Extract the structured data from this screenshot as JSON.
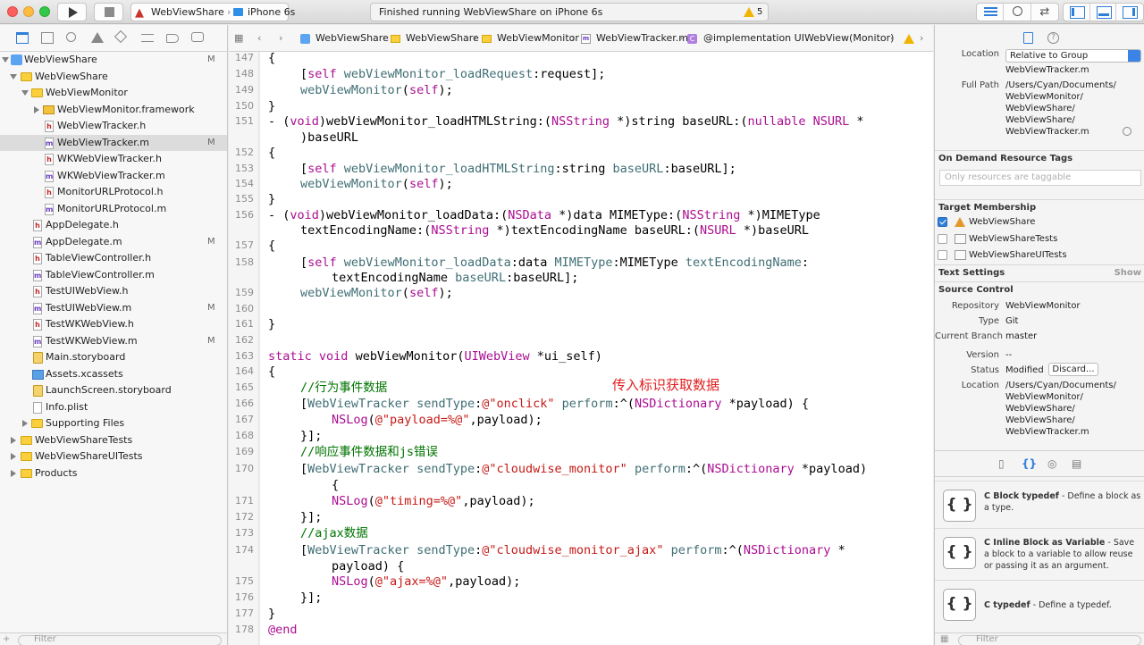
{
  "toolbar": {
    "scheme_name": "WebViewShare",
    "device_name": "iPhone 6s",
    "status_text": "Finished running WebViewShare on iPhone 6s",
    "warning_count": "5"
  },
  "navigator": {
    "filter_placeholder": "Filter",
    "items": [
      {
        "label": "WebViewShare",
        "scm": "M"
      },
      {
        "label": "WebViewShare",
        "scm": ""
      },
      {
        "label": "WebViewMonitor",
        "scm": ""
      },
      {
        "label": "WebViewMonitor.framework",
        "scm": ""
      },
      {
        "label": "WebViewTracker.h",
        "scm": ""
      },
      {
        "label": "WebViewTracker.m",
        "scm": "M"
      },
      {
        "label": "WKWebViewTracker.h",
        "scm": ""
      },
      {
        "label": "WKWebViewTracker.m",
        "scm": ""
      },
      {
        "label": "MonitorURLProtocol.h",
        "scm": ""
      },
      {
        "label": "MonitorURLProtocol.m",
        "scm": ""
      },
      {
        "label": "AppDelegate.h",
        "scm": ""
      },
      {
        "label": "AppDelegate.m",
        "scm": "M"
      },
      {
        "label": "TableViewController.h",
        "scm": ""
      },
      {
        "label": "TableViewController.m",
        "scm": ""
      },
      {
        "label": "TestUIWebView.h",
        "scm": ""
      },
      {
        "label": "TestUIWebView.m",
        "scm": "M"
      },
      {
        "label": "TestWKWebView.h",
        "scm": ""
      },
      {
        "label": "TestWKWebView.m",
        "scm": "M"
      },
      {
        "label": "Main.storyboard",
        "scm": ""
      },
      {
        "label": "Assets.xcassets",
        "scm": ""
      },
      {
        "label": "LaunchScreen.storyboard",
        "scm": ""
      },
      {
        "label": "Info.plist",
        "scm": ""
      },
      {
        "label": "Supporting Files",
        "scm": ""
      },
      {
        "label": "WebViewShareTests",
        "scm": ""
      },
      {
        "label": "WebViewShareUITests",
        "scm": ""
      },
      {
        "label": "Products",
        "scm": ""
      }
    ]
  },
  "jumpbar": [
    "WebViewShare",
    "WebViewShare",
    "WebViewMonitor",
    "WebViewTracker.m",
    "@implementation UIWebView(Monitor)"
  ],
  "editor": {
    "line_numbers": [
      "147",
      "148",
      "149",
      "150",
      "151",
      "152",
      "153",
      "154",
      "155",
      "156",
      "157",
      "158",
      "159",
      "160",
      "161",
      "162",
      "163",
      "164",
      "165",
      "166",
      "167",
      "168",
      "169",
      "170",
      "171",
      "172",
      "173",
      "174",
      "175",
      "176",
      "177",
      "178"
    ],
    "annotation": "传入标识获取数据",
    "code": {
      "l147": "{",
      "l148_self": "self",
      "l148_method": "webViewMonitor_loadRequest",
      "l148_rest": ":request];",
      "l149_fn": "webViewMonitor",
      "l149_self": "self",
      "l150": "}",
      "l151_a": "- (",
      "l151_void": "void",
      "l151_b": ")webViewMonitor_loadHTMLString:(",
      "l151_cls": "NSString",
      "l151_c": " *)string baseURL:(",
      "l151_nullable": "nullable",
      "l151_cls2": "NSURL",
      "l151_d": " *",
      "l151_cont": ")baseURL",
      "l152": "{",
      "l153_self": "self",
      "l153_method": "webViewMonitor_loadHTMLString",
      "l153_a": ":string ",
      "l153_arg": "baseURL",
      "l153_b": ":baseURL];",
      "l154_fn": "webViewMonitor",
      "l154_self": "self",
      "l155": "}",
      "l156_a": "- (",
      "l156_void": "void",
      "l156_b": ")webViewMonitor_loadData:(",
      "l156_cls": "NSData",
      "l156_c": " *)data MIMEType:(",
      "l156_cls2": "NSString",
      "l156_d": " *)MIMEType",
      "l156_cont_a": "textEncodingName:(",
      "l156_cont_cls": "NSString",
      "l156_cont_b": " *)textEncodingName baseURL:(",
      "l156_cont_cls2": "NSURL",
      "l156_cont_c": " *)baseURL",
      "l157": "{",
      "l158_self": "self",
      "l158_method": "webViewMonitor_loadData",
      "l158_a": ":data ",
      "l158_arg1": "MIMEType",
      "l158_b": ":MIMEType ",
      "l158_arg2": "textEncodingName",
      "l158_c": ":",
      "l158_cont_a": "textEncodingName ",
      "l158_cont_arg": "baseURL",
      "l158_cont_b": ":baseURL];",
      "l159_fn": "webViewMonitor",
      "l159_self": "self",
      "l161": "}",
      "l163_static": "static",
      "l163_void": "void",
      "l163_a": " webViewMonitor(",
      "l163_cls": "UIWebView",
      "l163_b": " *ui_self)",
      "l164": "{",
      "l165": "//行为事件数据",
      "l166_cls": "WebViewTracker",
      "l166_sel1": "sendType",
      "l166_str": "@\"onclick\"",
      "l166_sel2": "perform",
      "l166_a": ":^(",
      "l166_cls2": "NSDictionary",
      "l166_b": " *payload) {",
      "l167_fn": "NSLog",
      "l167_str": "@\"payload=%@\"",
      "l167_rest": ",payload);",
      "l168": "}];",
      "l169": "//响应事件数据和js错误",
      "l170_cls": "WebViewTracker",
      "l170_sel1": "sendType",
      "l170_str": "@\"cloudwise_monitor\"",
      "l170_sel2": "perform",
      "l170_a": ":^(",
      "l170_cls2": "NSDictionary",
      "l170_b": " *payload)",
      "l170_cont": "{",
      "l171_fn": "NSLog",
      "l171_str": "@\"timing=%@\"",
      "l171_rest": ",payload);",
      "l172": "}];",
      "l173": "//ajax数据",
      "l174_cls": "WebViewTracker",
      "l174_sel1": "sendType",
      "l174_str": "@\"cloudwise_monitor_ajax\"",
      "l174_sel2": "perform",
      "l174_a": ":^(",
      "l174_cls2": "NSDictionary",
      "l174_b": " *",
      "l174_cont": "payload) {",
      "l175_fn": "NSLog",
      "l175_str": "@\"ajax=%@\"",
      "l175_rest": ",payload);",
      "l176": "}];",
      "l177": "}",
      "l178": "@end"
    }
  },
  "inspector": {
    "location_key": "Location",
    "location_value": "Relative to Group",
    "file_name": "WebViewTracker.m",
    "fullpath_key": "Full Path",
    "fullpath_lines": [
      "/Users/Cyan/Documents/",
      "WebViewMonitor/",
      "WebViewShare/",
      "WebViewShare/",
      "WebViewTracker.m"
    ],
    "on_demand_header": "On Demand Resource Tags",
    "tags_placeholder": "Only resources are taggable",
    "target_header": "Target Membership",
    "targets": [
      "WebViewShare",
      "WebViewShareTests",
      "WebViewShareUITests"
    ],
    "text_settings_header": "Text Settings",
    "text_settings_show": "Show",
    "source_control_header": "Source Control",
    "repository_key": "Repository",
    "repository_value": "WebViewMonitor",
    "type_key": "Type",
    "type_value": "Git",
    "branch_key": "Current Branch",
    "branch_value": "master",
    "version_key": "Version",
    "version_value": "--",
    "status_key": "Status",
    "status_value": "Modified",
    "discard_label": "Discard...",
    "sc_location_key": "Location",
    "sc_location_lines": [
      "/Users/Cyan/Documents/",
      "WebViewMonitor/",
      "WebViewShare/",
      "WebViewShare/",
      "WebViewTracker.m"
    ],
    "library": [
      {
        "title": "C Block typedef",
        "desc": " - Define a block as a type."
      },
      {
        "title": "C Inline Block as Variable",
        "desc": " - Save a block to a variable to allow reuse or passing it as an argument."
      },
      {
        "title": "C typedef",
        "desc": " - Define a typedef."
      }
    ],
    "filter_placeholder": "Filter"
  }
}
